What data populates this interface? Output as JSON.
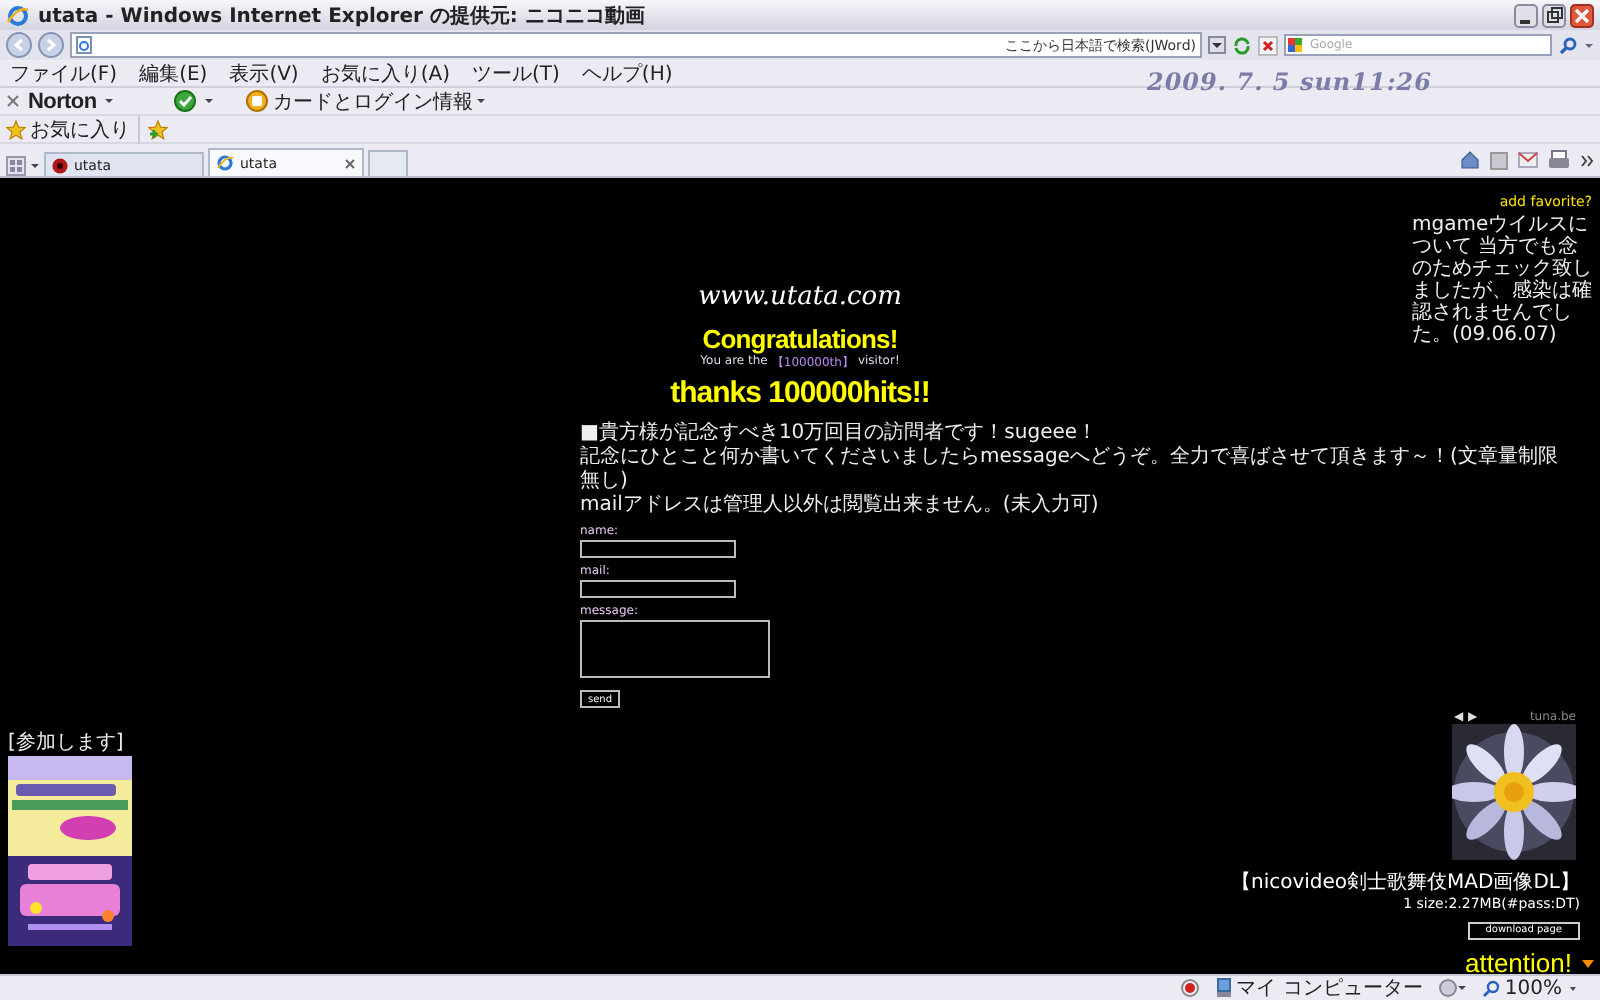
{
  "window": {
    "title": "utata - Windows Internet Explorer の提供元: ニコニコ動画"
  },
  "address_bar": {
    "search_hint": "ここから日本語で検索(JWord)",
    "search_placeholder": "Google"
  },
  "menu": [
    "ファイル(F)",
    "編集(E)",
    "表示(V)",
    "お気に入り(A)",
    "ツール(T)",
    "ヘルプ(H)"
  ],
  "clock": "2009. 7. 5 sun11:26",
  "norton_toolbar": {
    "brand": "Norton",
    "card_menu": "カードとログイン情報"
  },
  "favorites_bar": {
    "label": "お気に入り"
  },
  "tabs": [
    {
      "label": "utata",
      "selected": false
    },
    {
      "label": "utata",
      "selected": true
    }
  ],
  "page": {
    "favorite_link": "add favorite?",
    "notice": "mgameウイルスについて 当方でも念のためチェック致しましたが、感染は確認されませんでした。(09.06.07)",
    "site": "www.utata.com",
    "congrats": "Congratulations!",
    "visitor_prefix": "You are the",
    "counter": "【100000th】",
    "visitor_suffix": "visitor!",
    "thanks": "thanks 100000hits!!",
    "intro": [
      "■貴方様が記念すべき10万回目の訪問者です！sugeee！",
      "記念にひとこと何か書いてくださいましたらmessageへどうぞ。全力で喜ばさせて頂きます～！(文章量制限無し)",
      "mailアドレスは管理人以外は閲覧出来ません。(未入力可)"
    ],
    "form": {
      "name_label": "name:",
      "mail_label": "mail:",
      "message_label": "message:",
      "send": "send"
    },
    "banner_caption": "[参加します]",
    "nav_arrows": [
      "◀",
      "▶"
    ],
    "photo_credit": "tuna.be",
    "download_title": "【nicovideo剣士歌舞伎MAD画像DL】",
    "download_info": "1 size:2.27MB(#pass:DT)",
    "download_button": "download page",
    "attention": "attention!"
  },
  "status_bar": {
    "zone": "マイ コンピューター",
    "zoom": "100%"
  }
}
